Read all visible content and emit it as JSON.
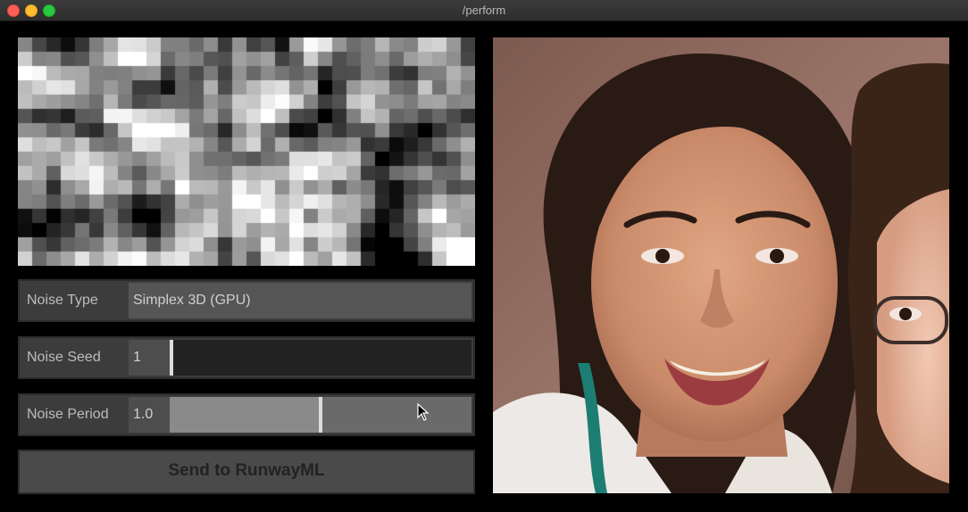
{
  "window": {
    "title": "/perform"
  },
  "noise_preview": {
    "description_icon": "noise-grid"
  },
  "controls": {
    "noise_type": {
      "label": "Noise Type",
      "value": "Simplex 3D (GPU)"
    },
    "noise_seed": {
      "label": "Noise Seed",
      "value": "1",
      "level": 0.0
    },
    "noise_period": {
      "label": "Noise Period",
      "value": "1.0",
      "level": 0.5
    }
  },
  "send_button": {
    "label": "Send to RunwayML"
  },
  "colors": {
    "background": "#000000",
    "row_bg": "#3c3c3c",
    "field_bg": "#222222"
  }
}
